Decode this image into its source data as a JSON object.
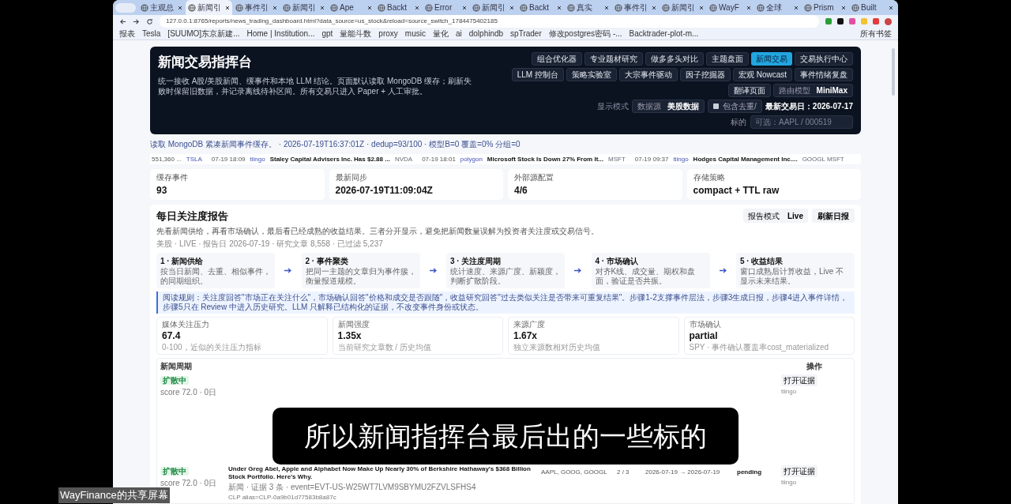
{
  "browser": {
    "tabs": [
      {
        "label": "主观总",
        "selected": false
      },
      {
        "label": "新闻引",
        "selected": true
      },
      {
        "label": "事件引",
        "selected": false
      },
      {
        "label": "新闻引",
        "selected": false
      },
      {
        "label": "Ape",
        "selected": false
      },
      {
        "label": "Backt",
        "selected": false
      },
      {
        "label": "Error",
        "selected": false
      },
      {
        "label": "新闻引",
        "selected": false
      },
      {
        "label": "Backt",
        "selected": false
      },
      {
        "label": "真实",
        "selected": false
      },
      {
        "label": "事件引",
        "selected": false
      },
      {
        "label": "新闻引",
        "selected": false
      },
      {
        "label": "WayF",
        "selected": false
      },
      {
        "label": "全球",
        "selected": false
      },
      {
        "label": "Prism",
        "selected": false
      },
      {
        "label": "Built",
        "selected": false
      }
    ],
    "url": "127.0.0.1:8765/reports/news_trading_dashboard.html?data_source=us_stock&reload=source_switch_1784475402185",
    "bookmarks": [
      "报表",
      "Tesla",
      "[SUUMO]东京新建...",
      "Home | Institution...",
      "gpt",
      "量能斗数",
      "proxy",
      "music",
      "量化",
      "ai",
      "dolphindb",
      "spTrader",
      "修改postgres密码 -...",
      "Backtrader-plot-m..."
    ],
    "all_bookmarks": "所有书签"
  },
  "header": {
    "title": "新闻交易指挥台",
    "description": "统一接收 A股/美股新闻、缓事件和本地 LLM 结论。页面默认读取 MongoDB 缓存；刷新失败时保留旧数据，并记录离线待补区间。所有交易只进入 Paper + 人工审批。",
    "nav": [
      {
        "label": "组合优化器",
        "selected": false
      },
      {
        "label": "专业题材研究",
        "selected": false
      },
      {
        "label": "做多多头对比",
        "selected": false
      },
      {
        "label": "主题盘面",
        "selected": false
      },
      {
        "label": "新闻交易",
        "selected": true
      },
      {
        "label": "交易执行中心",
        "selected": false
      },
      {
        "label": "LLM 控制台",
        "selected": false
      },
      {
        "label": "策略实验室",
        "selected": false
      },
      {
        "label": "大宗事件驱动",
        "selected": false
      },
      {
        "label": "因子挖掘器",
        "selected": false
      },
      {
        "label": "宏观 Nowcast",
        "selected": false
      },
      {
        "label": "事件情绪复盘",
        "selected": false
      },
      {
        "label": "翻译页面",
        "selected": false
      }
    ],
    "model_select": {
      "label": "路由模型",
      "value": "MiniMax"
    },
    "mode_label": "显示模式",
    "source_select": {
      "label": "数据源",
      "value": "美股数据"
    },
    "dedupe": {
      "label": "包含去重/",
      "checked": false
    },
    "last_trade_day": "最新交易日：2026-07-17",
    "symbol": {
      "label": "标的",
      "placeholder": "可选：AAPL / 000519"
    }
  },
  "status_line": "读取 MongoDB 紧凑新闻事件缓存。 · 2026-07-19T16:37:01Z · dedup=93/100 · 模型B=0 覆盖=0% 分组=0",
  "ticker": [
    {
      "time": "551,360 ...",
      "source": "TSLA"
    },
    {
      "time": "07-19 18:09",
      "source": "tiingo",
      "headline": "Staley Capital Advisers Inc. Has $2.88 ...",
      "tickers": "NVDA"
    },
    {
      "time": "07-19 18:01",
      "source": "polygon",
      "headline": "Microsoft Stock Is Down 27% From It...",
      "tickers": "MSFT"
    },
    {
      "time": "07-19 09:37",
      "source": "tiingo",
      "headline": "Hodges Capital Management Inc....",
      "tickers": "GOOGL MSFT"
    }
  ],
  "stats": [
    {
      "label": "缓存事件",
      "value": "93"
    },
    {
      "label": "最新同步",
      "value": "2026-07-19T11:09:04Z"
    },
    {
      "label": "外部源配置",
      "value": "4/6"
    },
    {
      "label": "存储策略",
      "value": "compact + TTL raw"
    }
  ],
  "report": {
    "title": "每日关注度报告",
    "description": "先看新闻供给，再看市场确认，最后看已经成熟的收益结果。三者分开显示，避免把新闻数量误解为投资者关注度或交易信号。",
    "meta": "美股 · LIVE · 报告日 2026-07-19 · 研究文章 8,558 · 已过滤 5,237",
    "mode": {
      "label": "报告模式",
      "value": "Live"
    },
    "refresh": "刷新日报",
    "steps": [
      {
        "title": "1 · 新闻供给",
        "text": "按当日新闻、去重、相似事件，的同期组织。"
      },
      {
        "title": "2 · 事件聚类",
        "text": "把同一主题的文章归为事件簇，衡量报道规模。"
      },
      {
        "title": "3 · 关注度周期",
        "text": "统计速度、来源广度、新颖度，判断扩散阶段。"
      },
      {
        "title": "4 · 市场确认",
        "text": "对齐K线、成交量、期权和盘面，验证是否共振。"
      },
      {
        "title": "5 · 收益结果",
        "text": "窗口成熟后计算收益，Live 不显示未来结果。"
      }
    ],
    "note": "阅读规则：关注度回答\"市场正在关注什么\"，市场确认回答\"价格和成交是否跟随\"，收益研究回答\"过去类似关注是否带来可重复结果\"。步骤1-2支撑事件层法，步骤3生成日报，步骤4进入事件详情，步骤5只在 Review 中进入历史研究。LLM 只解释已结构化的证据，不改变事件身份或状态。",
    "metrics": [
      {
        "label": "媒体关注压力",
        "value": "67.4",
        "sub": "0-100，近似的关注压力指标"
      },
      {
        "label": "新闻强度",
        "value": "1.35x",
        "sub": "当前研究文章数 / 历史均值"
      },
      {
        "label": "来源广度",
        "value": "1.67x",
        "sub": "独立来源数相对历史均值"
      },
      {
        "label": "市场确认",
        "value": "partial",
        "sub": "SPY · 事件确认覆盖率cost_materialized"
      }
    ],
    "table": {
      "columns": [
        "新闻周期",
        "操作"
      ],
      "rows": [
        {
          "badge": "扩散中",
          "score": "score 72.0 · 0日",
          "action": "打开证据",
          "source": "tiingo"
        },
        {
          "badge": "扩散中",
          "score": "score 72.0 · 0日",
          "headline": "Under Greg Abel, Apple and Alphabet Now Make Up Nearly 30% of Berkshire Hathaway's $368 Billion Stock Portfolio. Here's Why.",
          "sub": "新闻 · 证据 3 条 · event=EVT-US-W25WT7LVM9SBYMU2FZVLSFHS4",
          "alias": "CLP alias=CLP-0a9b01d77583b8a87c",
          "tickers": "AAPL, GOOG, GOOGL",
          "count": "2 / 3",
          "window": "2026-07-19 → 2026-07-19",
          "status": "pending",
          "action": "打开证据",
          "source": "tiingo"
        }
      ]
    }
  },
  "caption": "所以新闻指挥台最后出的一些标的",
  "share_label": "WayFinance的共享屏幕"
}
